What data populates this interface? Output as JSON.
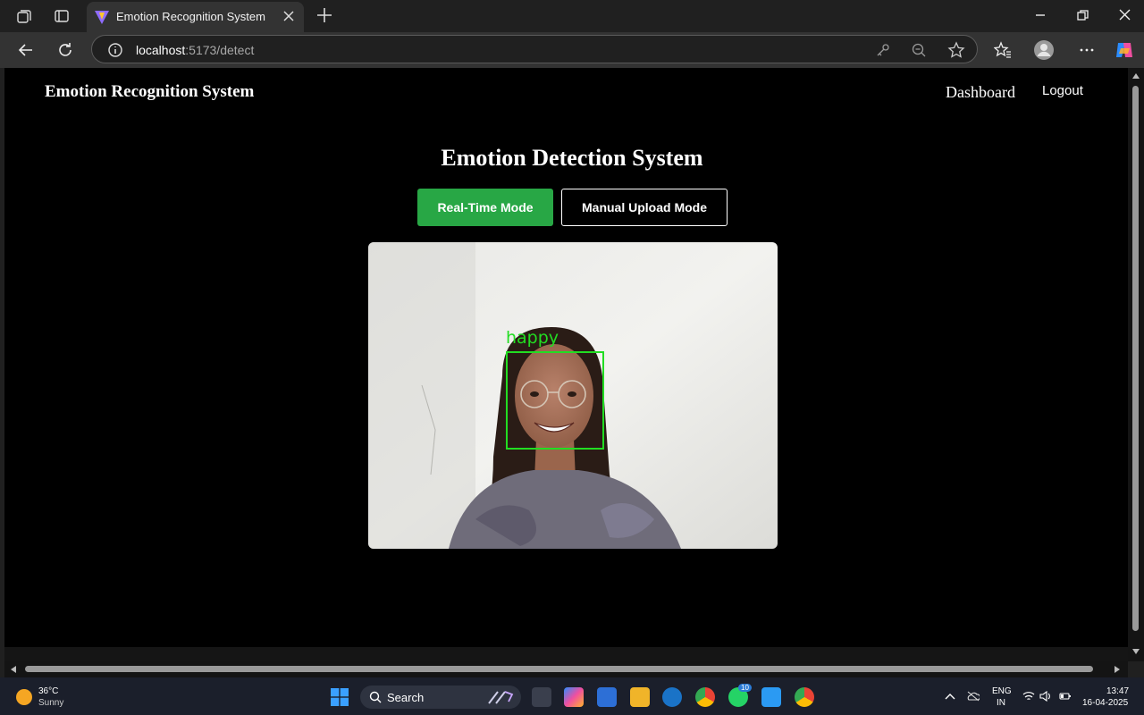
{
  "browser": {
    "tab_title": "Emotion Recognition System",
    "url_host": "localhost",
    "url_path": ":5173/detect"
  },
  "page": {
    "brand": "Emotion Recognition System",
    "nav": {
      "dashboard": "Dashboard",
      "logout": "Logout"
    },
    "heading": "Emotion Detection System",
    "modes": {
      "realtime": "Real-Time Mode",
      "upload": "Manual Upload Mode"
    },
    "detection": {
      "label": "happy"
    }
  },
  "taskbar": {
    "weather_temp": "36°C",
    "weather_cond": "Sunny",
    "search_label": "Search",
    "whatsapp_badge": "10",
    "lang_1": "ENG",
    "lang_2": "IN",
    "time": "13:47",
    "date": "16-04-2025"
  },
  "colors": {
    "accent": "#28a745",
    "detection": "#22dd22"
  },
  "icons": [
    "workspaces-icon",
    "tab-actions-icon",
    "vite-favicon-icon",
    "close-icon",
    "plus-icon",
    "minimize-icon",
    "restore-icon",
    "back-icon",
    "refresh-icon",
    "info-icon",
    "key-icon",
    "zoom-out-icon",
    "star-icon",
    "favorites-icon",
    "profile-icon",
    "more-icon",
    "copilot-icon"
  ]
}
